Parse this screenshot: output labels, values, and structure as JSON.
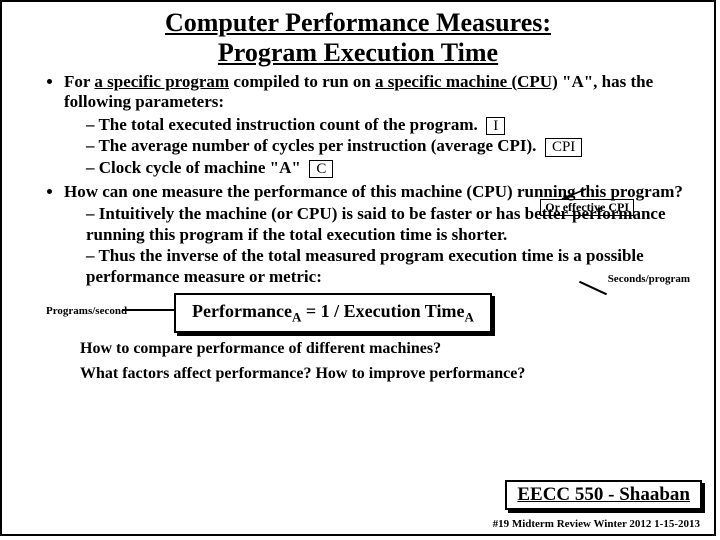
{
  "title_line1": "Computer Performance Measures:",
  "title_line2": "Program Execution Time",
  "bullet1_pre": "For ",
  "bullet1_u1": "a specific program",
  "bullet1_mid": " compiled to run on ",
  "bullet1_u2": "a specific machine (CPU)",
  "bullet1_post": " \"A\", has the following parameters:",
  "d1": "The total executed instruction count of the program.",
  "d1_box": "I",
  "d2": "The average number of cycles per instruction (average CPI).",
  "d2_box": "CPI",
  "d3_pre": "Clock cycle of machine \"A\"",
  "d3_box": "C",
  "cpi_note": "Or effective CPI",
  "bullet2": "How can one measure the performance of this machine (CPU) running this program?",
  "d4": "Intuitively the machine (or CPU) is said to be faster or has better performance running this program if the total execution time is shorter.",
  "d5": "Thus the inverse of the total measured program execution time is a possible performance measure or metric:",
  "label_left": "Programs/second",
  "label_right": "Seconds/program",
  "formula_perf": "Performance",
  "formula_sub": "A",
  "formula_mid": "  =   1  /   Execution Time",
  "q1": "How to compare performance of different machines?",
  "q2": "What factors affect performance?  How to improve performance?",
  "course": "EECC 550 - Shaaban",
  "footer": "#19   Midterm Review   Winter 2012  1-15-2013"
}
